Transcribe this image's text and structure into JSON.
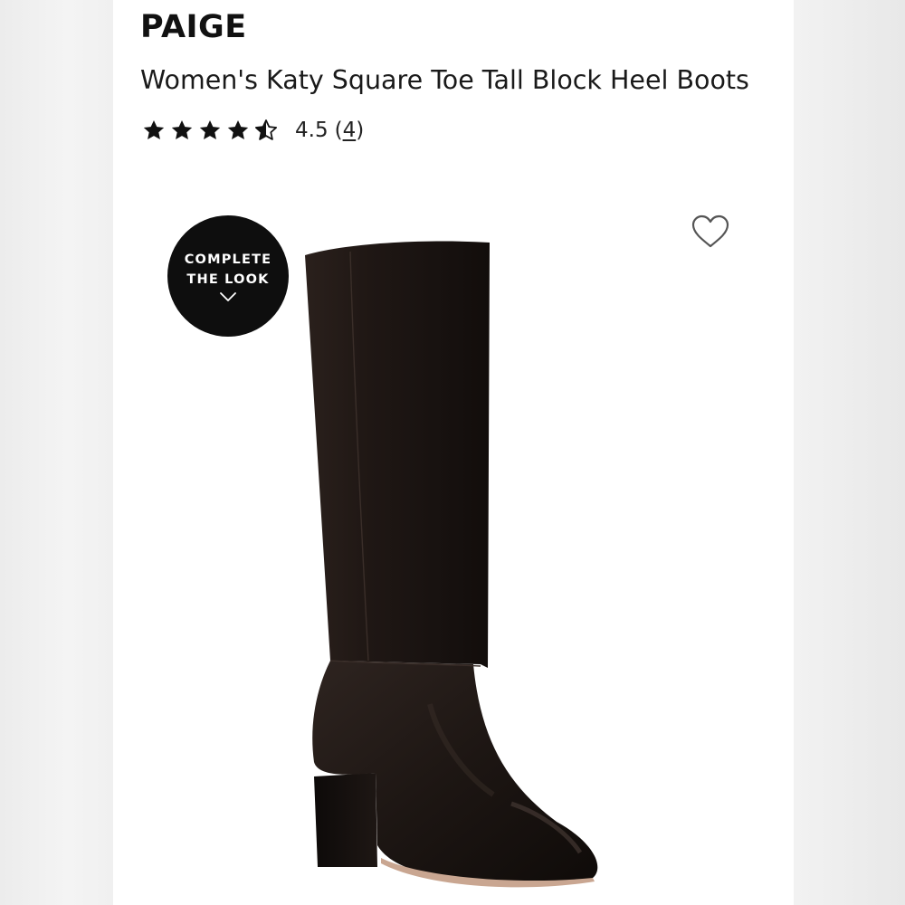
{
  "product": {
    "brand": "PAIGE",
    "title": "Women's Katy Square Toe Tall Block Heel Boots",
    "rating": {
      "stars_value": 4.5,
      "stars_max": 5,
      "value_text": "4.5",
      "count_open": "(",
      "count": "4",
      "count_close": ")"
    }
  },
  "badge": {
    "line1": "COMPLETE",
    "line2": "THE LOOK",
    "icon": "chevron-down-icon"
  },
  "wishlist": {
    "icon": "heart-outline-icon"
  },
  "image": {
    "subject": "tall black leather block heel boot",
    "colors": {
      "leather": "#1c1512",
      "background": "#ffffff"
    }
  }
}
